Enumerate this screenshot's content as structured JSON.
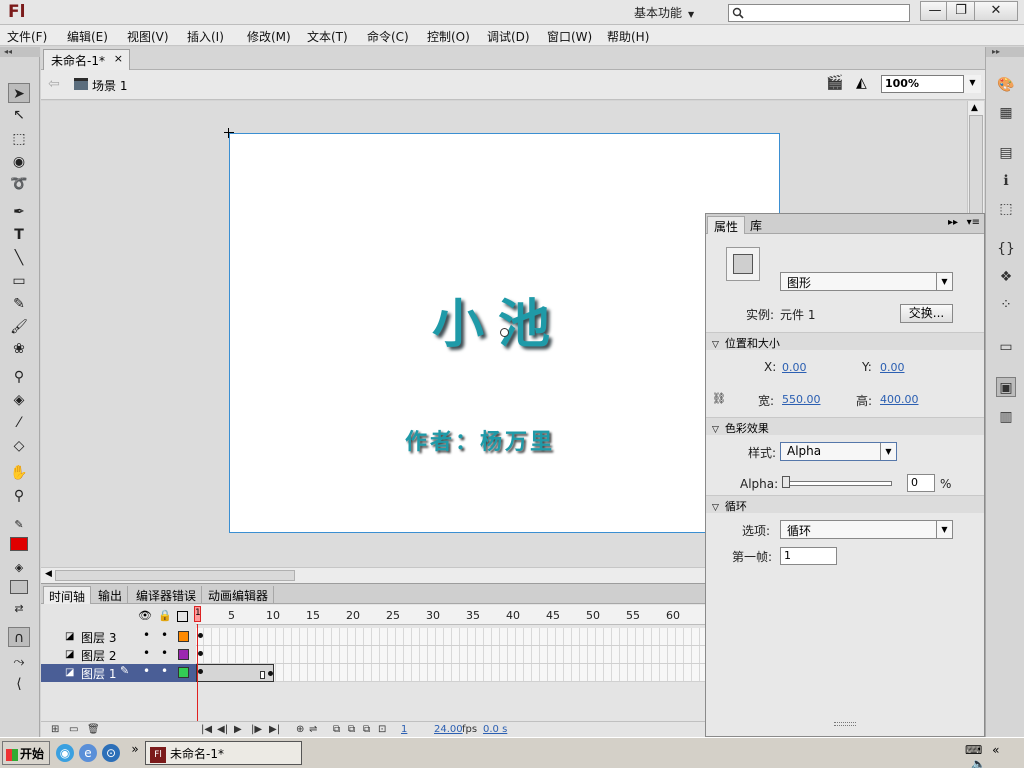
{
  "window": {
    "app_logo": "Fl",
    "workspace": "基本功能",
    "search_placeholder": "",
    "min": "—",
    "max": "❐",
    "close": "✕"
  },
  "menu": [
    "文件(F)",
    "编辑(E)",
    "视图(V)",
    "插入(I)",
    "修改(M)",
    "文本(T)",
    "命令(C)",
    "控制(O)",
    "调试(D)",
    "窗口(W)",
    "帮助(H)"
  ],
  "document": {
    "tab_label": "未命名-1*",
    "tab_close": "×",
    "scene_label": "场景 1",
    "zoom": "100%"
  },
  "stage": {
    "title_text": "小池",
    "author_text": "作者：杨万里",
    "text_color": "#1f9aa8",
    "stage_border_color": "#3b8fd2"
  },
  "timeline": {
    "tabs": [
      "时间轴",
      "输出",
      "编译器错误",
      "动画编辑器"
    ],
    "frame_numbers": [
      "1",
      "5",
      "10",
      "15",
      "20",
      "25",
      "30",
      "35",
      "40",
      "45",
      "50",
      "55",
      "60"
    ],
    "layers": [
      {
        "name": "图层 3",
        "color": "#ff8a00",
        "selected": false
      },
      {
        "name": "图层 2",
        "color": "#9c27b0",
        "selected": false
      },
      {
        "name": "图层 1",
        "color": "#33cc55",
        "selected": true
      }
    ],
    "footer": {
      "current_frame": "1",
      "fps": "24.00",
      "fps_unit": "fps",
      "time": "0.0 s"
    }
  },
  "properties": {
    "tabs": [
      "属性",
      "库"
    ],
    "symbol_type": "图形",
    "instance_label": "实例:",
    "instance_name": "元件 1",
    "swap_button": "交换...",
    "position_section": "位置和大小",
    "x_label": "X:",
    "x_value": "0.00",
    "y_label": "Y:",
    "y_value": "0.00",
    "width_label": "宽:",
    "width_value": "550.00",
    "height_label": "高:",
    "height_value": "400.00",
    "color_section": "色彩效果",
    "style_label": "样式:",
    "style_value": "Alpha",
    "alpha_label": "Alpha:",
    "alpha_value": "0",
    "alpha_unit": "%",
    "loop_section": "循环",
    "options_label": "选项:",
    "options_value": "循环",
    "first_frame_label": "第一帧:",
    "first_frame_value": "1"
  },
  "taskbar": {
    "start": "开始",
    "task_label": "未命名-1*"
  }
}
